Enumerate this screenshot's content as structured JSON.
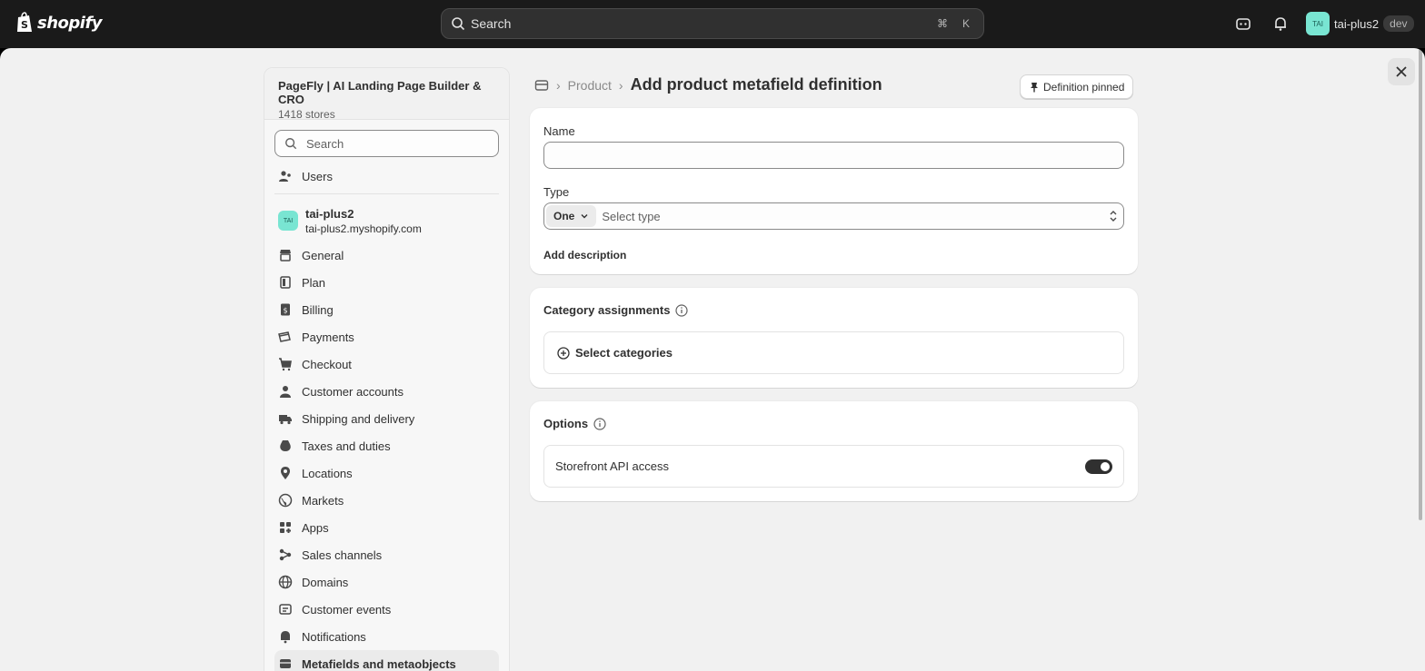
{
  "topbar": {
    "logo_text": "shopify",
    "search_placeholder": "Search",
    "shortcut_keys": [
      "⌘",
      "K"
    ],
    "user_initials": "TAI",
    "user_name": "tai-plus2",
    "user_badge": "dev"
  },
  "sidebar": {
    "app_name": "PageFly | AI Landing Page Builder & CRO",
    "app_stores": "1418 stores",
    "search_placeholder": "Search",
    "users_label": "Users",
    "store": {
      "initials": "TAI",
      "name": "tai-plus2",
      "domain": "tai-plus2.myshopify.com"
    },
    "items": [
      {
        "label": "General",
        "icon": "store-icon"
      },
      {
        "label": "Plan",
        "icon": "plan-icon"
      },
      {
        "label": "Billing",
        "icon": "billing-icon"
      },
      {
        "label": "Payments",
        "icon": "payments-icon"
      },
      {
        "label": "Checkout",
        "icon": "cart-icon"
      },
      {
        "label": "Customer accounts",
        "icon": "person-icon"
      },
      {
        "label": "Shipping and delivery",
        "icon": "truck-icon"
      },
      {
        "label": "Taxes and duties",
        "icon": "tax-icon"
      },
      {
        "label": "Locations",
        "icon": "location-icon"
      },
      {
        "label": "Markets",
        "icon": "globe-icon"
      },
      {
        "label": "Apps",
        "icon": "apps-icon"
      },
      {
        "label": "Sales channels",
        "icon": "channels-icon"
      },
      {
        "label": "Domains",
        "icon": "domain-icon"
      },
      {
        "label": "Customer events",
        "icon": "events-icon"
      },
      {
        "label": "Notifications",
        "icon": "bell-icon"
      },
      {
        "label": "Metafields and metaobjects",
        "icon": "metafields-icon",
        "active": true
      }
    ]
  },
  "breadcrumb": {
    "parent": "Product",
    "title": "Add product metafield definition"
  },
  "pin_button": "Definition pinned",
  "form": {
    "name_label": "Name",
    "name_value": "",
    "type_label": "Type",
    "type_cardinality": "One",
    "type_placeholder": "Select type",
    "add_description": "Add description"
  },
  "categories": {
    "title": "Category assignments",
    "select_label": "Select categories"
  },
  "options": {
    "title": "Options",
    "storefront_label": "Storefront API access",
    "storefront_enabled": true
  }
}
